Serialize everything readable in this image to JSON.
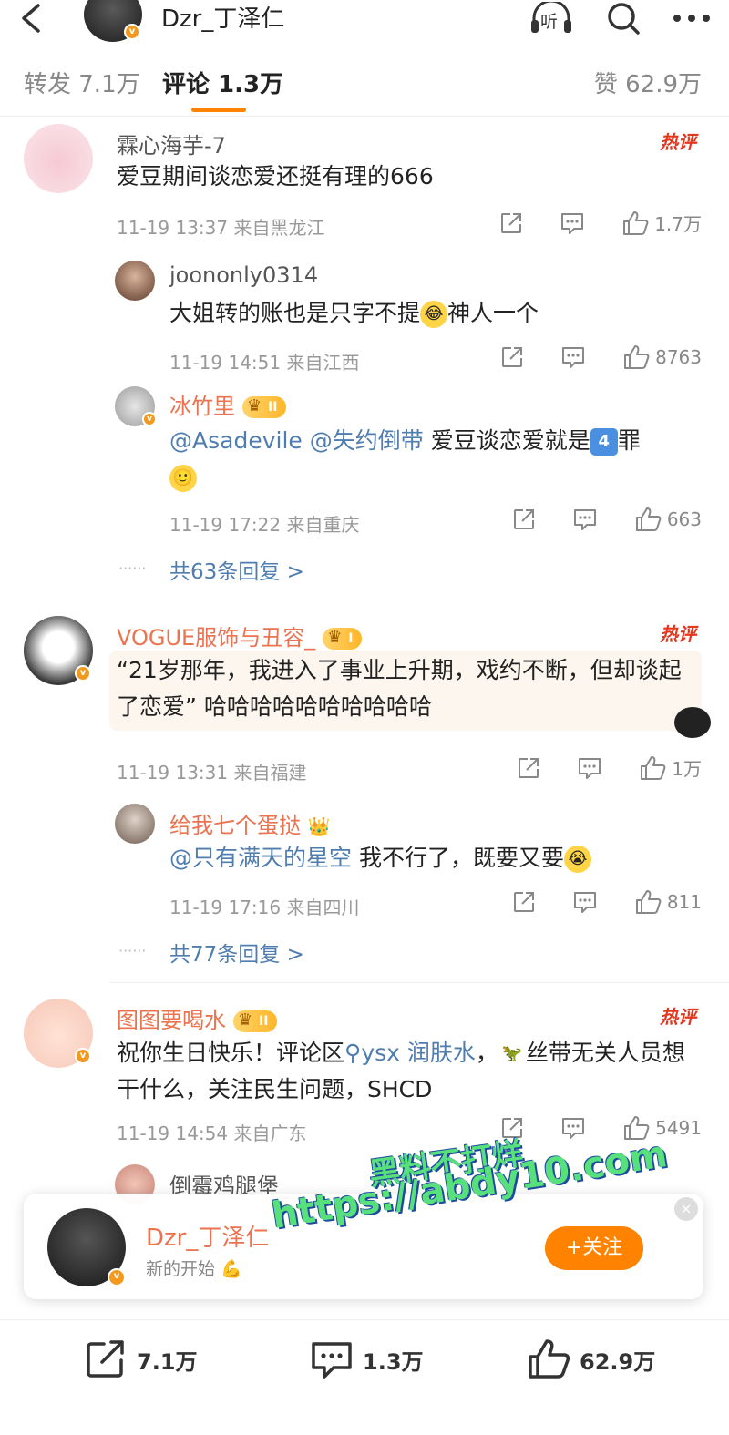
{
  "header": {
    "title": "Dzr_丁泽仁",
    "listen_label": "听"
  },
  "tabs": {
    "repost": "转发 7.1万",
    "comments": "评论 1.3万",
    "likes": "赞 62.9万"
  },
  "hot_label": "热评",
  "comments": [
    {
      "user": "霖心海芋-7",
      "text": "爱豆期间谈恋爱还挺有理的666",
      "time": "11-19 13:37",
      "location": "来自黑龙江",
      "likes": "1.7万",
      "replies": [
        {
          "user": "joononly0314",
          "text": "大姐转的账也是只字不提",
          "text_tail": "神人一个",
          "time": "11-19 14:51",
          "location": "来自江西",
          "likes": "8763"
        },
        {
          "user": "冰竹里",
          "badge": "II",
          "mention1": "@Asadevile",
          "mention2": "@失约倒带",
          "text": "爱豆谈恋爱就是",
          "text_tail": "罪",
          "num_emoji": "4",
          "time": "11-19 17:22",
          "location": "来自重庆",
          "likes": "663"
        }
      ],
      "more_replies": "共63条回复 >"
    },
    {
      "user": "VOGUE服饰与丑容_",
      "badge": "I",
      "text": "“21岁那年，我进入了事业上升期，戏约不断，但却谈起了恋爱” 哈哈哈哈哈哈哈哈哈哈",
      "time": "11-19 13:31",
      "location": "来自福建",
      "likes": "1万",
      "replies": [
        {
          "user": "给我七个蛋挞",
          "mention": "@只有满天的星空",
          "text": "我不行了，既要又要",
          "time": "11-19 17:16",
          "location": "来自四川",
          "likes": "811"
        }
      ],
      "more_replies": "共77条回复 >"
    },
    {
      "user": "图图要喝水",
      "badge": "II",
      "text_prefix": "祝你生日快乐！评论区",
      "search_term": "ysx 润肤水",
      "text_mid": "，",
      "text_suffix": "丝带无关人员想干什么，关注民生问题，SHCD",
      "time": "11-19 14:54",
      "location": "来自广东",
      "likes": "5491",
      "replies": [
        {
          "user": "倒霉鸡腿堡_"
        }
      ]
    }
  ],
  "follow_card": {
    "name": "Dzr_丁泽仁",
    "subtitle": "新的开始",
    "button": "+关注",
    "close": "×"
  },
  "watermark": {
    "line1": "黑料不打烊",
    "line2": "https://abdy10.com"
  },
  "bottom_bar": {
    "repost": "7.1万",
    "comments": "1.3万",
    "likes": "62.9万"
  },
  "colors": {
    "accent": "#ff8200",
    "username_vip": "#eb7350",
    "link": "#507daf",
    "hot": "#e6361e"
  }
}
